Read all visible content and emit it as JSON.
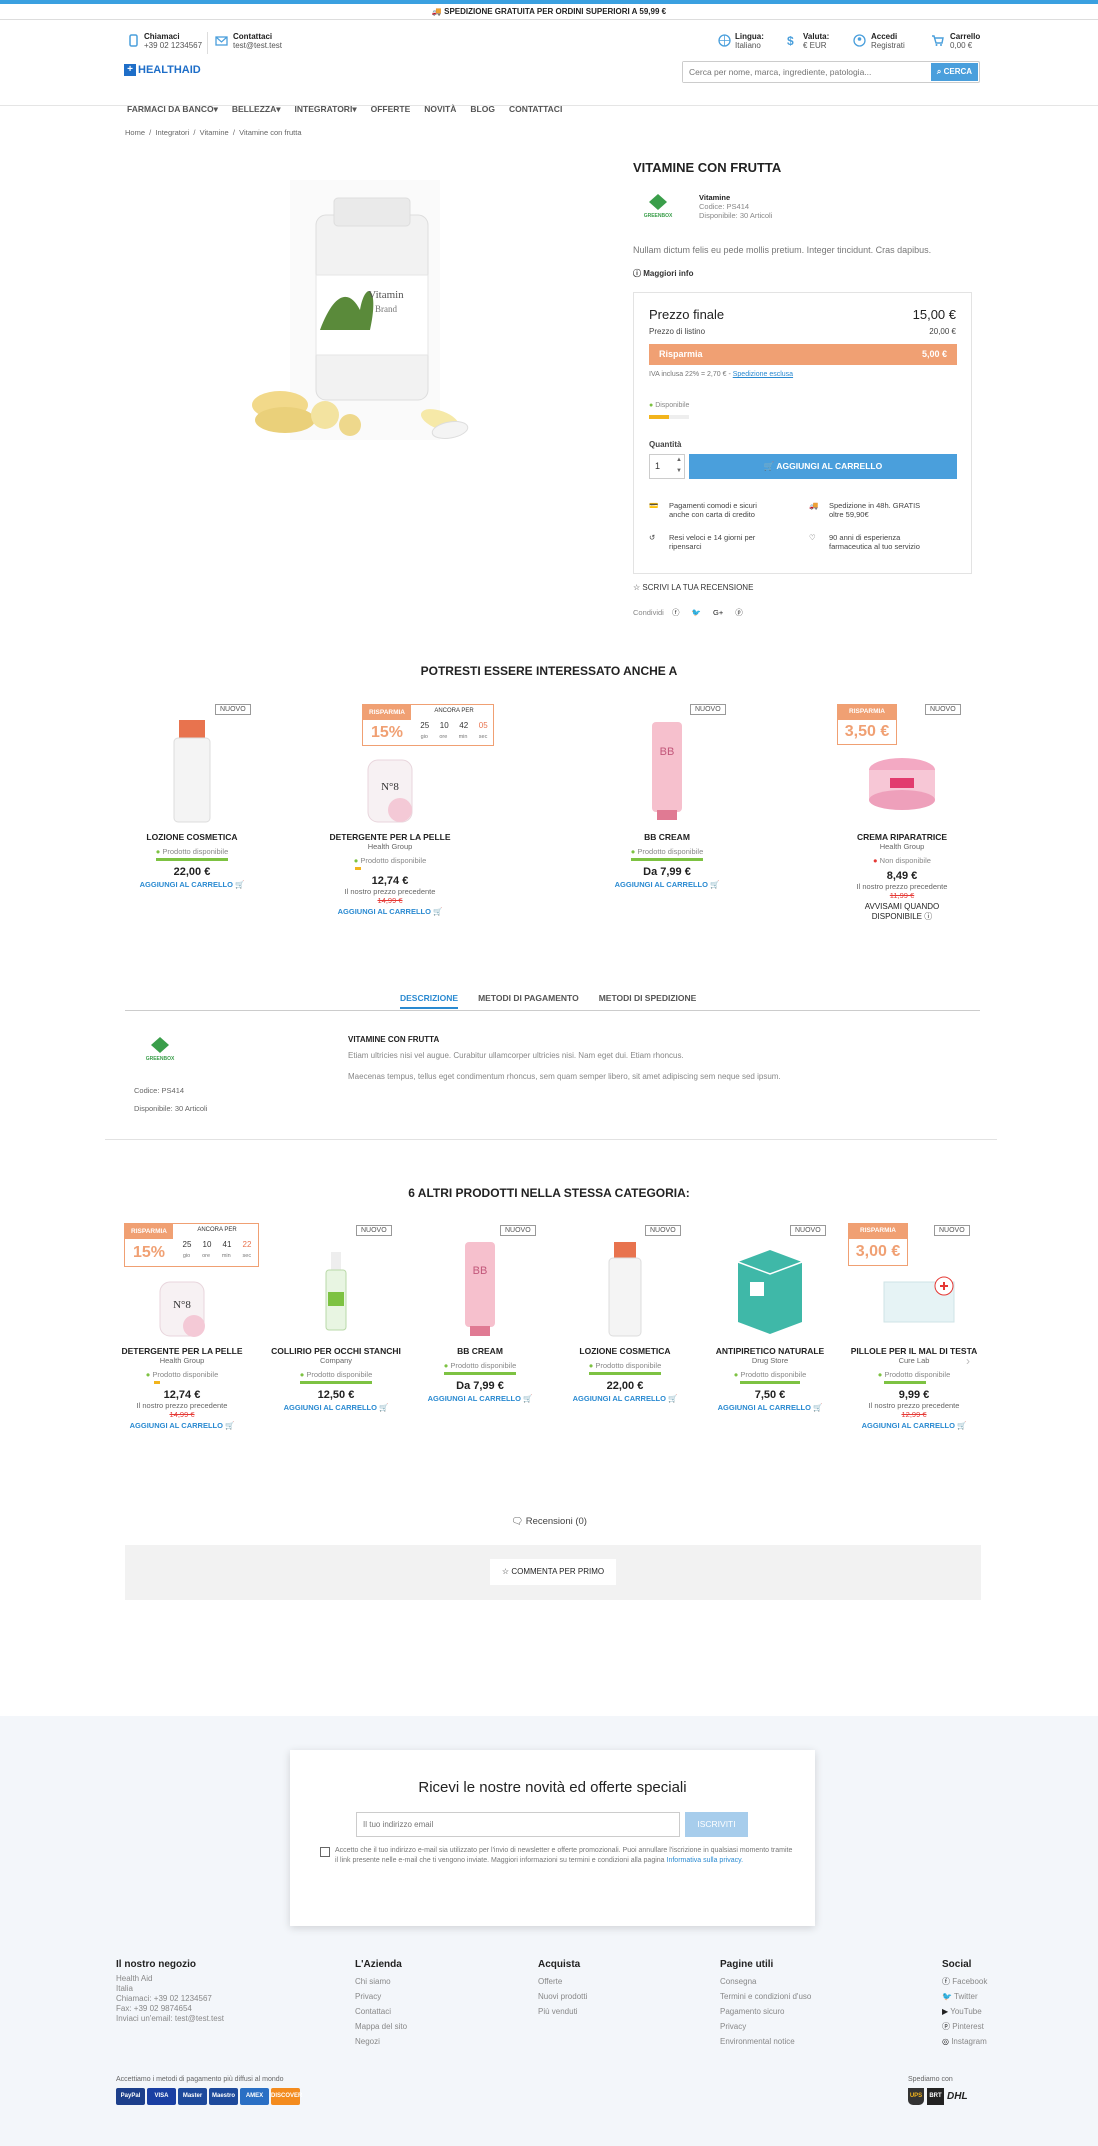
{
  "shipping_banner": "SPEDIZIONE GRATUITA PER ORDINI SUPERIORI A 59,99 €",
  "header": {
    "call": {
      "label": "Chiamaci",
      "value": "+39 02 1234567"
    },
    "contact": {
      "label": "Contattaci",
      "value": "test@test.test"
    },
    "language": {
      "label": "Lingua:",
      "value": "Italiano"
    },
    "currency": {
      "label": "Valuta:",
      "value": "€ EUR"
    },
    "login": {
      "label": "Accedi",
      "value": "Registrati"
    },
    "cart": {
      "label": "Carrello",
      "value": "0,00 €"
    },
    "logo": "HEALTHAID",
    "search_placeholder": "Cerca per nome, marca, ingrediente, patologia...",
    "search_button": "CERCA",
    "nav": [
      "FARMACI DA BANCO",
      "BELLEZZA",
      "INTEGRATORI",
      "OFFERTE",
      "NOVITÀ",
      "BLOG",
      "CONTATTACI"
    ]
  },
  "breadcrumb": [
    "Home",
    "Integratori",
    "Vitamine",
    "Vitamine con frutta"
  ],
  "product": {
    "title": "VITAMINE CON FRUTTA",
    "brand_logo": "GREENBOX",
    "category": "Vitamine",
    "code": "Codice: PS414",
    "available": "Disponibile: 30 Articoli",
    "short_desc": "Nullam dictum felis eu pede mollis pretium. Integer tincidunt. Cras dapibus.",
    "more_info": "Maggiori info",
    "bottle_label": "Vitamin",
    "bottle_brand": "Brand",
    "final_price_label": "Prezzo finale",
    "final_price": "15,00 €",
    "list_price_label": "Prezzo di listino",
    "list_price": "20,00 €",
    "save_label": "Risparmia",
    "save_value": "5,00 €",
    "tax_note": "IVA inclusa 22% = 2,70 € - ",
    "tax_link": "Spedizione esclusa",
    "availability": "Disponibile",
    "quantity_label": "Quantità",
    "quantity": "1",
    "add_to_cart": "AGGIUNGI AL CARRELLO",
    "features": [
      "Pagamenti comodi e sicuri anche con carta di credito",
      "Spedizione in 48h. GRATIS oltre 59,90€",
      "Resi veloci e 14 giorni per ripensarci",
      "90 anni di esperienza farmaceutica al tuo servizio"
    ],
    "write_review": "SCRIVI LA TUA RECENSIONE",
    "share": "Condividi"
  },
  "related": {
    "title": "POTRESTI ESSERE INTERESSATO ANCHE A",
    "items": [
      {
        "name": "LOZIONE COSMETICA",
        "sub": "",
        "avail": "Prodotto disponibile",
        "price": "22,00 €",
        "old": "",
        "prev": "",
        "action": "AGGIUNGI AL CARRELLO",
        "badge": "NUOVO"
      },
      {
        "name": "DETERGENTE PER LA PELLE",
        "sub": "Health Group",
        "avail": "Prodotto disponibile",
        "price": "12,74 €",
        "old": "14,99 €",
        "prev": "Il nostro prezzo precedente",
        "action": "AGGIUNGI AL CARRELLO",
        "badge": "15%"
      },
      {
        "name": "BB CREAM",
        "sub": "",
        "avail": "Prodotto disponibile",
        "price": "Da 7,99 €",
        "old": "",
        "prev": "",
        "action": "AGGIUNGI AL CARRELLO",
        "badge": "NUOVO"
      },
      {
        "name": "CREMA RIPARATRICE",
        "sub": "Health Group",
        "avail": "Non disponibile",
        "price": "8,49 €",
        "old": "11,99 €",
        "prev": "Il nostro prezzo precedente",
        "action": "AVVISAMI QUANDO DISPONIBILE",
        "badge": "3,50 €"
      }
    ],
    "countdown": {
      "label": "ANCORA PER",
      "values": [
        "25",
        "10",
        "42",
        "05"
      ],
      "units": [
        "gio",
        "ore",
        "min",
        "sec"
      ],
      "tag": "RISPARMIA"
    }
  },
  "tabs": [
    "DESCRIZIONE",
    "METODI DI PAGAMENTO",
    "METODI DI SPEDIZIONE"
  ],
  "description": {
    "title": "VITAMINE CON FRUTTA",
    "p1": "Etiam ultricies nisi vel augue. Curabitur ullamcorper ultricies nisi. Nam eget dui. Etiam rhoncus.",
    "p2": "Maecenas tempus, tellus eget condimentum rhoncus, sem quam semper libero, sit amet adipiscing sem neque sed ipsum.",
    "code": "Codice: PS414",
    "available": "Disponibile: 30 Articoli"
  },
  "category_products": {
    "title": "6 ALTRI PRODOTTI NELLA STESSA CATEGORIA:",
    "items": [
      {
        "name": "DETERGENTE PER LA PELLE",
        "sub": "Health Group",
        "price": "12,74 €",
        "old": "14,99 €",
        "badge": "15%"
      },
      {
        "name": "COLLIRIO PER OCCHI STANCHI",
        "sub": "Company",
        "price": "12,50 €",
        "old": "",
        "badge": "NUOVO"
      },
      {
        "name": "BB CREAM",
        "sub": "",
        "price": "Da 7,99 €",
        "old": "",
        "badge": "NUOVO"
      },
      {
        "name": "LOZIONE COSMETICA",
        "sub": "",
        "price": "22,00 €",
        "old": "",
        "badge": "NUOVO"
      },
      {
        "name": "ANTIPIRETICO NATURALE",
        "sub": "Drug Store",
        "price": "7,50 €",
        "old": "",
        "badge": "NUOVO"
      },
      {
        "name": "PILLOLE PER IL MAL DI TESTA",
        "sub": "Cure Lab",
        "price": "9,99 €",
        "old": "12,99 €",
        "badge": "3,00 €"
      }
    ],
    "countdown_values": [
      "25",
      "10",
      "41",
      "22"
    ],
    "avail": "Prodotto disponibile",
    "prev": "Il nostro prezzo precedente",
    "action": "AGGIUNGI AL CARRELLO"
  },
  "reviews": {
    "label": "Recensioni (0)",
    "button": "COMMENTA PER PRIMO"
  },
  "newsletter": {
    "title": "Ricevi le nostre novità ed offerte speciali",
    "placeholder": "Il tuo indirizzo email",
    "button": "ISCRIVITI",
    "consent": "Accetto che il tuo indirizzo e-mail sia utilizzato per l'invio di newsletter e offerte promozionali. Puoi annullare l'iscrizione in qualsiasi momento tramite il link presente nelle e-mail che ti vengono inviate. Maggiori informazioni su termini e condizioni alla pagina ",
    "consent_link": "Informativa sulla privacy."
  },
  "footer": {
    "store": {
      "title": "Il nostro negozio",
      "lines": [
        "Health Aid",
        "Italia",
        "Chiamaci: +39 02 1234567",
        "Fax: +39 02 9874654",
        "Inviaci un'email: test@test.test"
      ]
    },
    "company": {
      "title": "L'Azienda",
      "links": [
        "Chi siamo",
        "Privacy",
        "Contattaci",
        "Mappa del sito",
        "Negozi"
      ]
    },
    "shop": {
      "title": "Acquista",
      "links": [
        "Offerte",
        "Nuovi prodotti",
        "Più venduti"
      ]
    },
    "useful": {
      "title": "Pagine utili",
      "links": [
        "Consegna",
        "Termini e condizioni d'uso",
        "Pagamento sicuro",
        "Privacy",
        "Environmental notice"
      ]
    },
    "social": {
      "title": "Social",
      "links": [
        "Facebook",
        "Twitter",
        "YouTube",
        "Pinterest",
        "Instagram"
      ]
    },
    "payments_label": "Accettiamo i metodi di pagamento più diffusi al mondo",
    "payments": [
      "PayPal",
      "VISA",
      "Master",
      "Maestro",
      "AMEX",
      "DISCOVER"
    ],
    "ship_label": "Spediamo con",
    "carriers": [
      "UPS",
      "BRT",
      "DHL"
    ]
  },
  "colors": {
    "accent": "#4a9fdc",
    "save": "#f0a073",
    "green": "#7dc242"
  }
}
